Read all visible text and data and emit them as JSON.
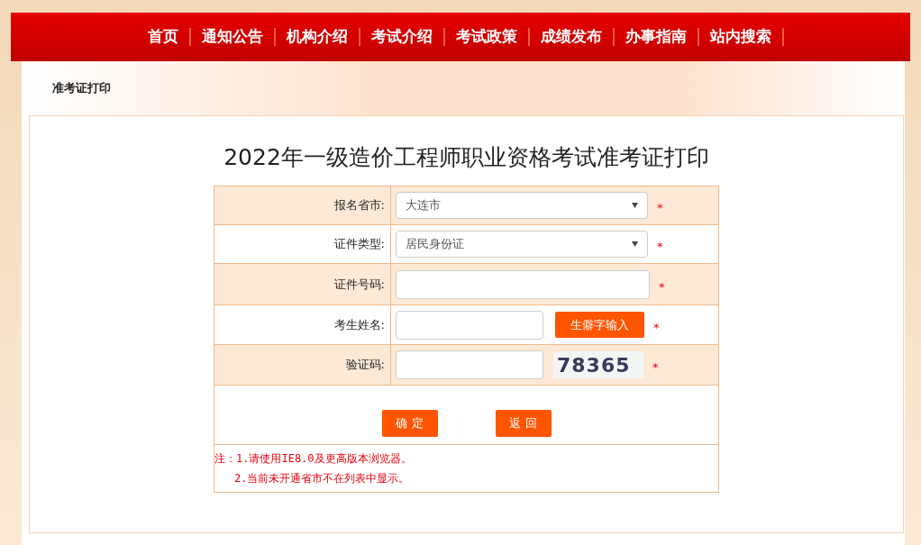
{
  "nav": [
    {
      "label": "首页"
    },
    {
      "label": "通知公告"
    },
    {
      "label": "机构介绍"
    },
    {
      "label": "考试介绍"
    },
    {
      "label": "考试政策"
    },
    {
      "label": "成绩发布"
    },
    {
      "label": "办事指南"
    },
    {
      "label": "站内搜索"
    }
  ],
  "breadcrumb": "准考证打印",
  "title": "2022年一级造价工程师职业资格考试准考证打印",
  "form": [
    {
      "kind": "select",
      "label": "报名省市:",
      "value": "大连市",
      "required": "*"
    },
    {
      "kind": "select",
      "label": "证件类型:",
      "value": "居民身份证",
      "required": "*"
    },
    {
      "kind": "input",
      "label": "证件号码:",
      "required": "*"
    },
    {
      "kind": "input_button",
      "label": "考生姓名:",
      "button": "生僻字输入",
      "required": "*"
    },
    {
      "kind": "captcha",
      "label": "验证码:",
      "captcha": "78365",
      "required": "*"
    }
  ],
  "buttons": [
    "确 定",
    "返 回"
  ],
  "notes": [
    "注：1.请使用IE8.0及更高版本浏览器。",
    "2.当前未开通省市不在列表中显示。"
  ]
}
